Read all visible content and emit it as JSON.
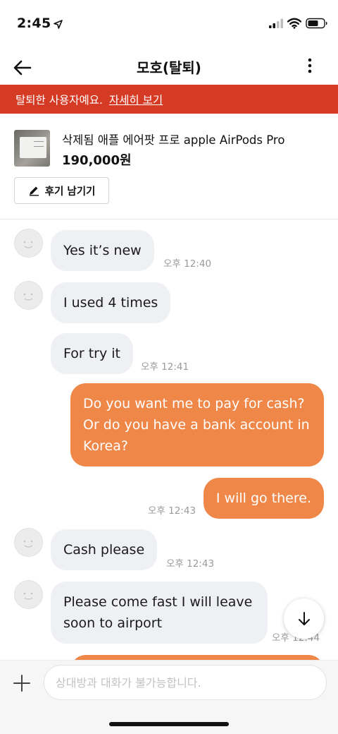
{
  "status_bar": {
    "time": "2:45"
  },
  "header": {
    "title": "모호(탈퇴)"
  },
  "banner": {
    "text": "탈퇴한 사용자예요.",
    "link": "자세히 보기",
    "color": "#d53a24"
  },
  "product": {
    "name": "삭제됨 애플 에어팟 프로 apple AirPods Pro",
    "price": "190,000원",
    "review_button": "후기 남기기"
  },
  "messages": [
    {
      "direction": "in",
      "text": "Yes it’s new",
      "time": "오후 12:40"
    },
    {
      "direction": "in",
      "text": "I used 4 times",
      "time": ""
    },
    {
      "direction": "in",
      "text": "For try it",
      "time": "오후 12:41"
    },
    {
      "direction": "out",
      "text": "Do you want me to pay for cash? Or do you have a bank account in Korea?",
      "time": ""
    },
    {
      "direction": "out",
      "text": "I will go there.",
      "time": "오후 12:43"
    },
    {
      "direction": "in",
      "text": "Cash please",
      "time": "오후 12:43"
    },
    {
      "direction": "in",
      "text": "Please come fast I will leave soon to airport",
      "time": "오후 12:44"
    }
  ],
  "input": {
    "placeholder": "상대방과 대화가 불가능합니다."
  },
  "colors": {
    "outgoing_bubble": "#ef8748",
    "incoming_bubble": "#eff0f3"
  }
}
